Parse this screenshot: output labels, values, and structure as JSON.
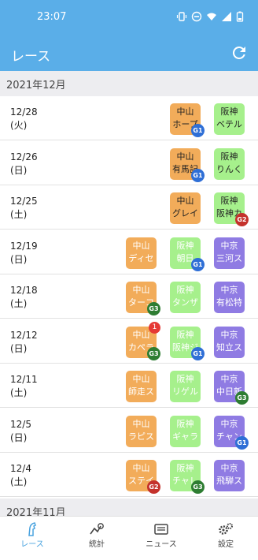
{
  "status_bar": {
    "time": "23:07"
  },
  "app_bar": {
    "title": "レース"
  },
  "months": {
    "dec": "2021年12月",
    "nov": "2021年11月"
  },
  "days": [
    {
      "date": "12/28",
      "weekday": "(火)",
      "chips": [
        {
          "l1": "中山",
          "l2": "ホープ",
          "color": "orange",
          "grade": "G1"
        },
        {
          "l1": "阪神",
          "l2": "ベテル",
          "color": "green"
        }
      ]
    },
    {
      "date": "12/26",
      "weekday": "(日)",
      "chips": [
        {
          "l1": "中山",
          "l2": "有馬記",
          "color": "orange",
          "grade": "G1"
        },
        {
          "l1": "阪神",
          "l2": "りんく",
          "color": "green"
        }
      ]
    },
    {
      "date": "12/25",
      "weekday": "(土)",
      "chips": [
        {
          "l1": "中山",
          "l2": "グレイ",
          "color": "orange"
        },
        {
          "l1": "阪神",
          "l2": "阪神カ",
          "color": "green",
          "grade": "G2"
        }
      ]
    },
    {
      "date": "12/19",
      "weekday": "(日)",
      "chips": [
        {
          "l1": "中山",
          "l2": "ディセ",
          "color": "orange"
        },
        {
          "l1": "阪神",
          "l2": "朝日",
          "color": "green",
          "grade": "G1"
        },
        {
          "l1": "中京",
          "l2": "三河ス",
          "color": "purple"
        }
      ]
    },
    {
      "date": "12/18",
      "weekday": "(土)",
      "chips": [
        {
          "l1": "中山",
          "l2": "ターコ",
          "color": "orange",
          "grade": "G3"
        },
        {
          "l1": "阪神",
          "l2": "タンザ",
          "color": "green"
        },
        {
          "l1": "中京",
          "l2": "有松特",
          "color": "purple"
        }
      ]
    },
    {
      "date": "12/12",
      "weekday": "(日)",
      "chips": [
        {
          "l1": "中山",
          "l2": "カペラ",
          "color": "orange",
          "grade": "G3",
          "badge": "1"
        },
        {
          "l1": "阪神",
          "l2": "阪神ジ",
          "color": "green",
          "grade": "G1"
        },
        {
          "l1": "中京",
          "l2": "知立ス",
          "color": "purple"
        }
      ]
    },
    {
      "date": "12/11",
      "weekday": "(土)",
      "chips": [
        {
          "l1": "中山",
          "l2": "師走ス",
          "color": "orange"
        },
        {
          "l1": "阪神",
          "l2": "リゲル",
          "color": "green"
        },
        {
          "l1": "中京",
          "l2": "中日新",
          "color": "purple",
          "grade": "G3"
        }
      ]
    },
    {
      "date": "12/5",
      "weekday": "(日)",
      "chips": [
        {
          "l1": "中山",
          "l2": "ラピス",
          "color": "orange"
        },
        {
          "l1": "阪神",
          "l2": "ギャラ",
          "color": "green"
        },
        {
          "l1": "中京",
          "l2": "チャン",
          "color": "purple",
          "grade": "G1"
        }
      ]
    },
    {
      "date": "12/4",
      "weekday": "(土)",
      "chips": [
        {
          "l1": "中山",
          "l2": "ステイ",
          "color": "orange",
          "grade": "G2"
        },
        {
          "l1": "阪神",
          "l2": "チャレ",
          "color": "green",
          "grade": "G3"
        },
        {
          "l1": "中京",
          "l2": "飛騨ス",
          "color": "purple"
        }
      ]
    }
  ],
  "bottom_nav": [
    {
      "label": "レース",
      "icon": "horse-icon",
      "active": true
    },
    {
      "label": "統計",
      "icon": "stats-icon"
    },
    {
      "label": "ニュース",
      "icon": "news-icon"
    },
    {
      "label": "設定",
      "icon": "settings-icon"
    }
  ],
  "colors": {
    "accent": "#5aaee8",
    "orange": "#f2ac5a",
    "green": "#a6f08c",
    "purple": "#8f7be3",
    "g1": "#2f6fd6",
    "g2": "#c4322c",
    "g3": "#2e7d32"
  }
}
